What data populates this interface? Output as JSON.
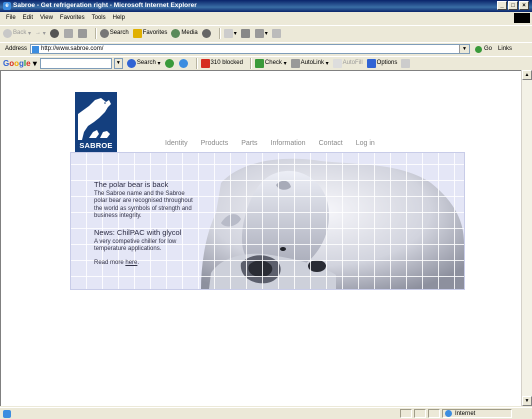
{
  "window": {
    "title": "Sabroe - Get refrigeration right - Microsoft Internet Explorer",
    "minimize": "_",
    "maximize": "□",
    "close": "×"
  },
  "menu": [
    "File",
    "Edit",
    "View",
    "Favorites",
    "Tools",
    "Help"
  ],
  "toolbar": {
    "back": "Back",
    "forward": "→",
    "search": "Search",
    "favorites": "Favorites",
    "media": "Media"
  },
  "address": {
    "label": "Address",
    "url": "http://www.sabroe.com/",
    "go": "Go",
    "links": "Links"
  },
  "googlebar": {
    "logo": [
      "G",
      "o",
      "o",
      "g",
      "l",
      "e"
    ],
    "search_button": "Search",
    "blocked": "310 blocked",
    "check": "Check",
    "autolink": "AutoLink",
    "autofill": "AutoFill",
    "options": "Options"
  },
  "page": {
    "logo_text": "SABROE",
    "nav": [
      "Identity",
      "Products",
      "Parts",
      "Information",
      "Contact",
      "Log in"
    ],
    "hero": {
      "heading1": "The polar bear is back",
      "body1": "The Sabroe name and the Sabroe polar bear are recognised throughout the world as symbols of strength and business integrity.",
      "heading2": "News: ChilPAC with glycol",
      "body2": "A very competive chiller for low temperature applications.",
      "readmore_prefix": "Read more ",
      "readmore_link": "here",
      "readmore_suffix": "."
    }
  },
  "status": {
    "zone": "Internet"
  },
  "colors": {
    "titlebar": "#0a246a",
    "logo_bg": "#143f7e",
    "hero_bg": "#e4e6f6",
    "nav_text": "#8a8a8a"
  }
}
